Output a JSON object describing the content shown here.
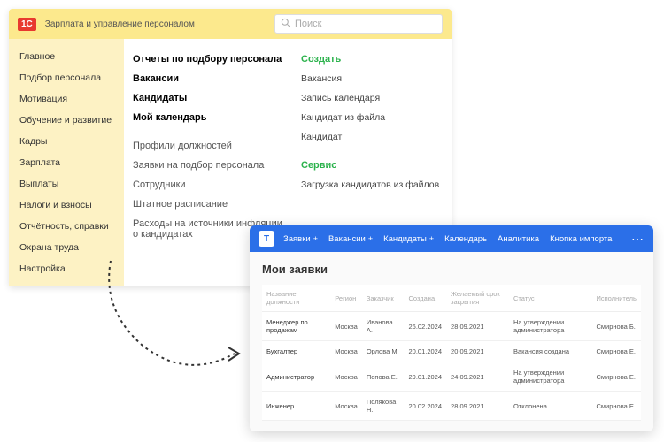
{
  "win1": {
    "logo_badge": "1C",
    "app_title": "Зарплата и управление персоналом",
    "search_placeholder": "Поиск",
    "sidebar": [
      "Главное",
      "Подбор персонала",
      "Мотивация",
      "Обучение и развитие",
      "Кадры",
      "Зарплата",
      "Выплаты",
      "Налоги и взносы",
      "Отчётность, справки",
      "Охрана труда",
      "Настройка"
    ],
    "col1_bold": [
      "Отчеты по подбору персонала",
      "Вакансии",
      "Кандидаты",
      "Мой календарь"
    ],
    "col1_light": [
      "Профили должностей",
      "Заявки на подбор персонала",
      "Сотрудники",
      "Штатное расписание",
      "Расходы на источники инфляции о кандидатах"
    ],
    "create_title": "Создать",
    "create_items": [
      "Вакансия",
      "Запись календаря",
      "Кандидат из файла",
      "Кандидат"
    ],
    "service_title": "Сервис",
    "service_items": [
      "Загрузка кандидатов из файлов"
    ]
  },
  "win2": {
    "logo": "T",
    "nav": [
      {
        "label": "Заявки",
        "plus": true
      },
      {
        "label": "Вакансии",
        "plus": true
      },
      {
        "label": "Кандидаты",
        "plus": true
      },
      {
        "label": "Календарь",
        "plus": false
      },
      {
        "label": "Аналитика",
        "plus": false
      },
      {
        "label": "Кнопка импорта",
        "plus": false
      }
    ],
    "title": "Мои заявки",
    "headers": [
      "Название должности",
      "Регион",
      "Заказчик",
      "Создана",
      "Желаемый срок закрытия",
      "Статус",
      "Исполнитель"
    ],
    "rows": [
      [
        "Менеджер по продажам",
        "Москва",
        "Иванова А.",
        "26.02.2024",
        "28.09.2021",
        "На утверждении администратора",
        "Смирнова Б."
      ],
      [
        "Бухгалтер",
        "Москва",
        "Орлова М.",
        "20.01.2024",
        "20.09.2021",
        "Вакансия создана",
        "Смирнова Е."
      ],
      [
        "Администратор",
        "Москва",
        "Попова Е.",
        "29.01.2024",
        "24.09.2021",
        "На утверждении администратора",
        "Смирнова Е."
      ],
      [
        "Инженер",
        "Москва",
        "Полякова Н.",
        "20.02.2024",
        "28.09.2021",
        "Отклонена",
        "Смирнова Е."
      ]
    ]
  }
}
